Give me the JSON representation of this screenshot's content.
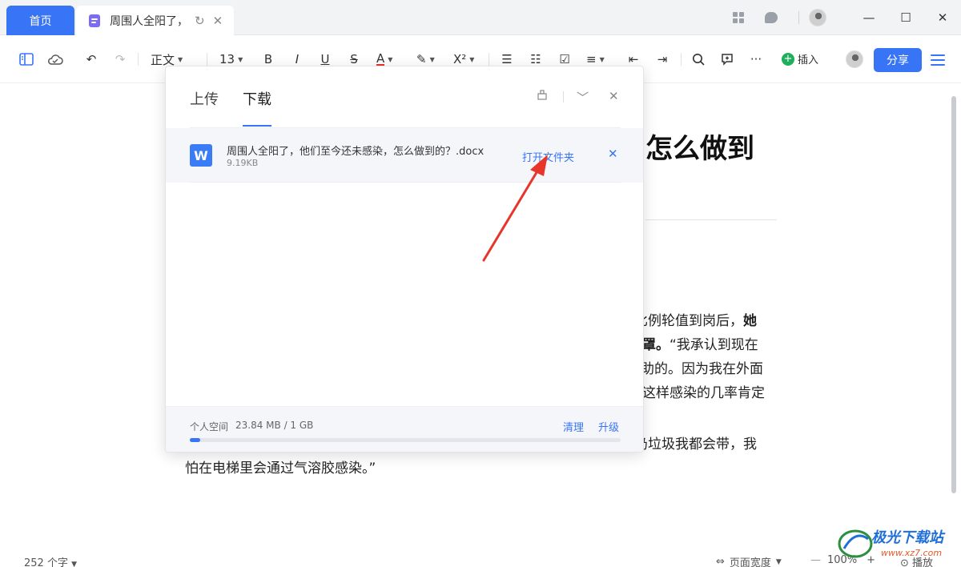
{
  "tabs": {
    "home": "首页",
    "doc_title": "周围人全阳了，"
  },
  "toolbar": {
    "style": "正文",
    "font_size": "13",
    "insert": "插入",
    "share": "分享"
  },
  "document": {
    "title_fragment": "怎么做到",
    "lines": [
      {
        "pre": "比例轮值到岗后，",
        "bold": "她"
      },
      {
        "bold": "罩。",
        "post": "“我承认到现在"
      },
      {
        "pre": "助的。因为我在外面"
      },
      {
        "pre": "这样感染的几率肯定"
      },
      {
        "pre": "扔垃圾我都会带，我"
      },
      {
        "pre": "怕在电梯里会通过气溶胶感染。”"
      }
    ]
  },
  "download_panel": {
    "tabs": [
      "上传",
      "下载"
    ],
    "active_tab": "下载",
    "file": {
      "name": "周围人全阳了，他们至今还未感染，怎么做到的？.docx",
      "size": "9.19KB",
      "icon_letter": "W",
      "action": "打开文件夹"
    },
    "footer": {
      "space_label": "个人空间",
      "space_value": "23.84 MB / 1 GB",
      "usage_fraction": 0.0233,
      "clean": "清理",
      "upgrade": "升级"
    }
  },
  "status_bar": {
    "word_count": "252 个字",
    "page_width": "页面宽度",
    "zoom": "100%",
    "play": "播放"
  },
  "watermark": {
    "text": "极光下载站",
    "url": "www.xz7.com"
  },
  "colors": {
    "accent": "#3875f6",
    "insert_green": "#1fae5b",
    "arrow_red": "#e8352b"
  }
}
